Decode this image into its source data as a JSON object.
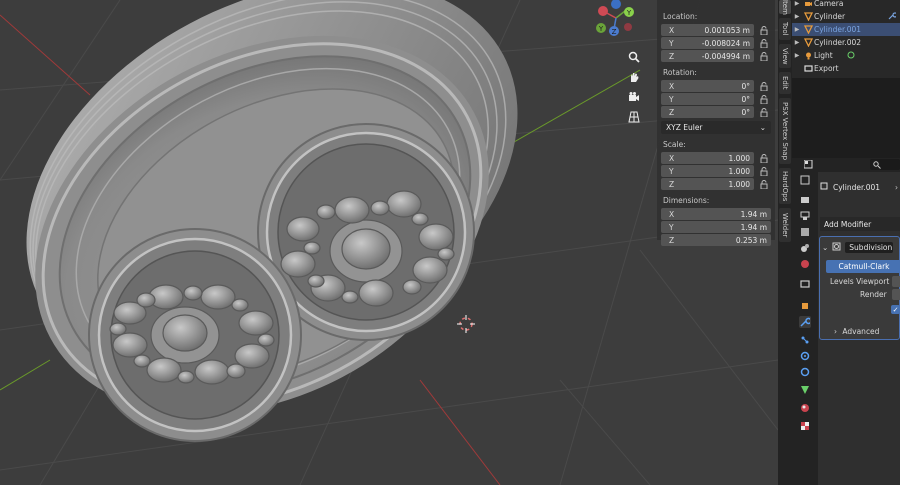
{
  "outliner": {
    "items": [
      {
        "label": "Camera",
        "selected": false,
        "highlight": false
      },
      {
        "label": "Cylinder",
        "selected": false,
        "highlight": false
      },
      {
        "label": "Cylinder.001",
        "selected": true,
        "highlight": true
      },
      {
        "label": "Cylinder.002",
        "selected": false,
        "highlight": false
      },
      {
        "label": "Light",
        "selected": false,
        "highlight": false
      },
      {
        "label": "Export",
        "selected": false,
        "highlight": false
      }
    ]
  },
  "npanel": {
    "location_label": "Location:",
    "location": {
      "x": "0.001053 m",
      "y": "-0.008024 m",
      "z": "-0.004994 m"
    },
    "rotation_label": "Rotation:",
    "rotation": {
      "x": "0°",
      "y": "0°",
      "z": "0°"
    },
    "rotation_mode": "XYZ Euler",
    "scale_label": "Scale:",
    "scale": {
      "x": "1.000",
      "y": "1.000",
      "z": "1.000"
    },
    "dimensions_label": "Dimensions:",
    "dimensions": {
      "x": "1.94 m",
      "y": "1.94 m",
      "z": "0.253 m"
    },
    "axis": {
      "x": "X",
      "y": "Y",
      "z": "Z"
    }
  },
  "vtabs": [
    "Item",
    "Tool",
    "View",
    "Edit",
    "PSX Vertex Snap",
    "HardOps",
    "Welder"
  ],
  "gizmo": {
    "x": "X",
    "y": "Y",
    "z": "Z"
  },
  "properties": {
    "object_name": "Cylinder.001",
    "add_modifier": "Add Modifier",
    "modifier_name": "Subdivision",
    "subdivision_type": "Catmull-Clark",
    "levels_viewport_label": "Levels Viewport",
    "render_label": "Render",
    "advanced_label": "Advanced"
  },
  "colors": {
    "viewport_bg": "#3d3d3d",
    "x_axis_line": "#a03a3a",
    "y_axis_line": "#6a9a2a",
    "selected_row": "#3b4e73",
    "accent": "#4772b3"
  }
}
